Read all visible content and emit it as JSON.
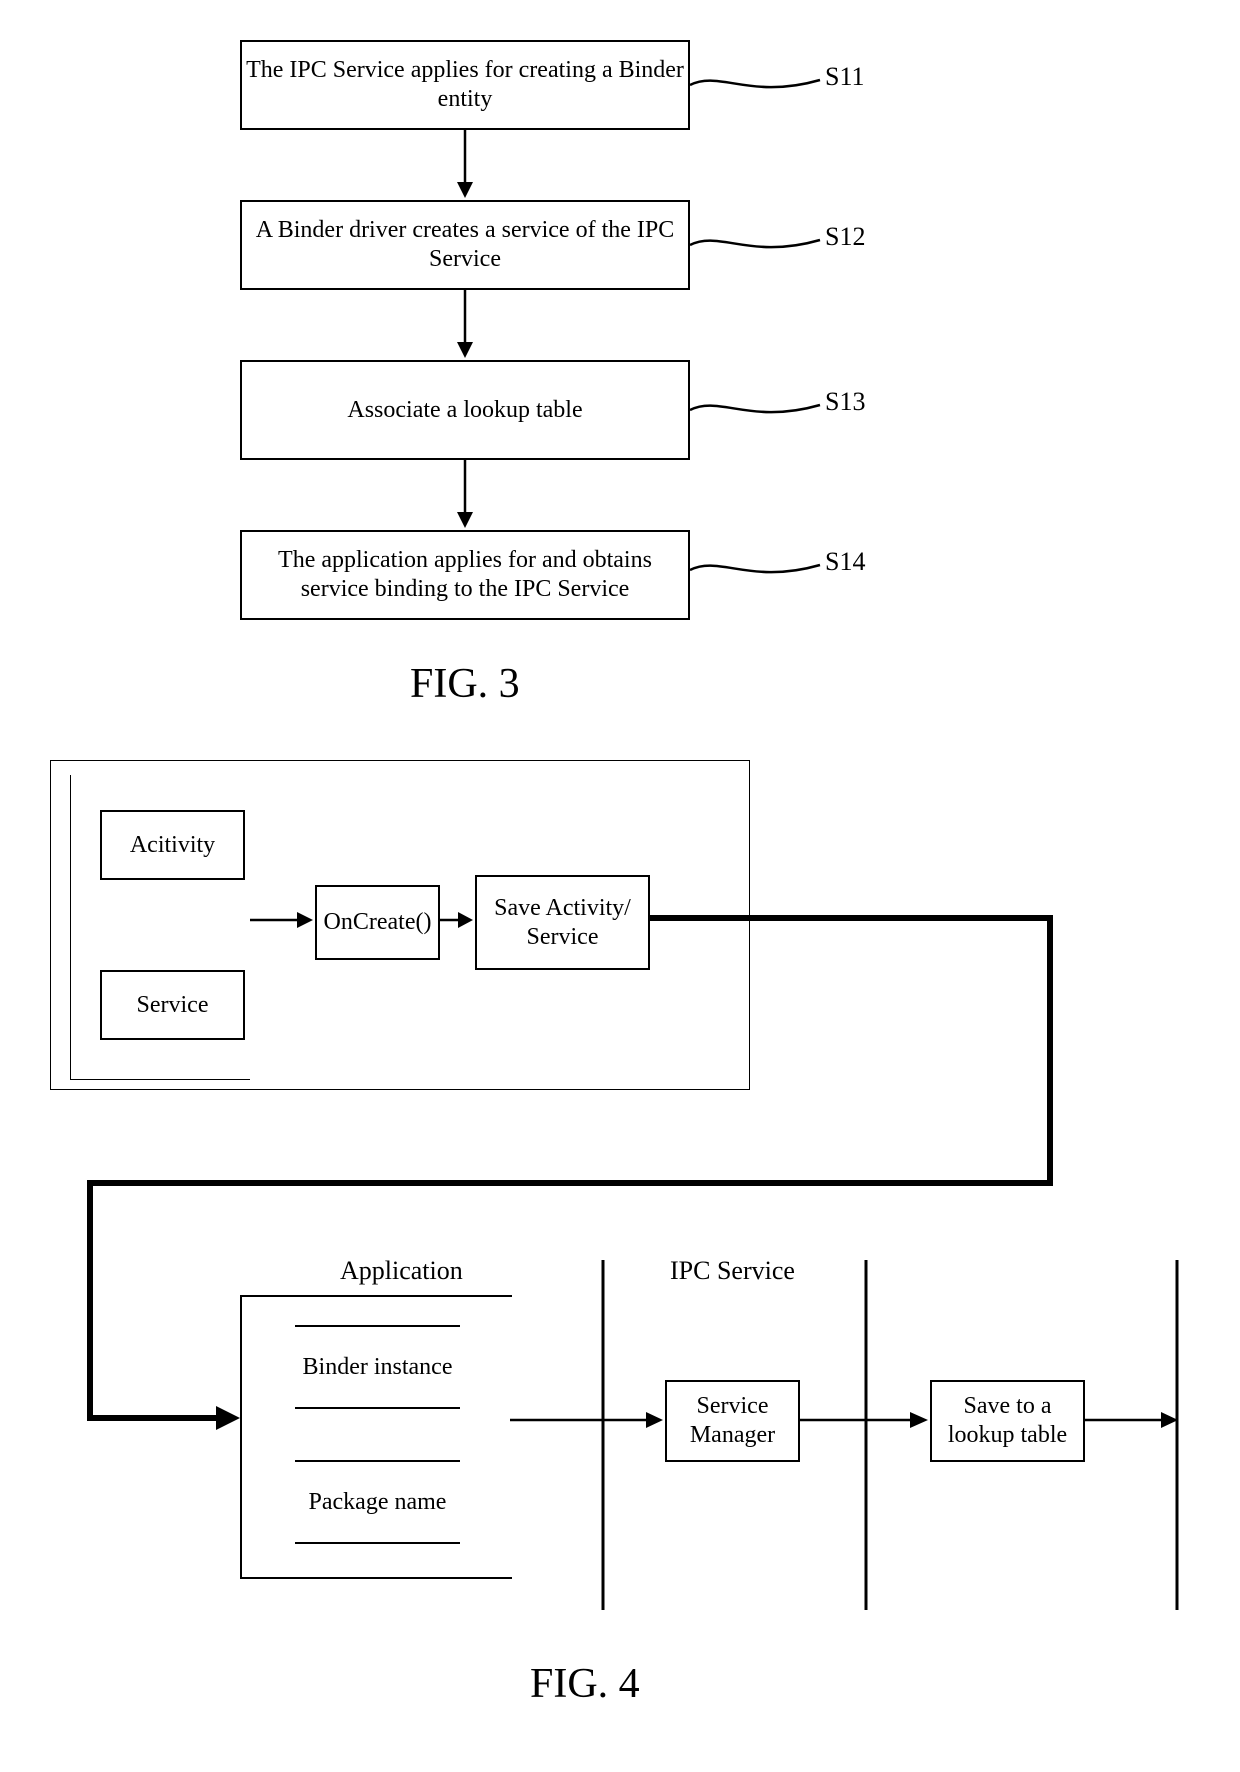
{
  "fig3": {
    "caption": "FIG. 3",
    "s11_label": "S11",
    "s12_label": "S12",
    "s13_label": "S13",
    "s14_label": "S14",
    "box1": "The IPC Service applies for creating a Binder entity",
    "box2": "A Binder driver creates a service of the IPC Service",
    "box3": "Associate a lookup table",
    "box4": "The application applies for and obtains service binding to the IPC Service"
  },
  "fig4": {
    "caption": "FIG. 4",
    "activity": "Acitivity",
    "service": "Service",
    "oncreate": "OnCreate()",
    "save_activity": "Save Activity/\nService",
    "application_heading": "Application",
    "ipc_heading": "IPC Service",
    "binder_instance": "Binder instance",
    "package_name": "Package name",
    "service_manager": "Service Manager",
    "lookup_table": "Save to a lookup table"
  }
}
